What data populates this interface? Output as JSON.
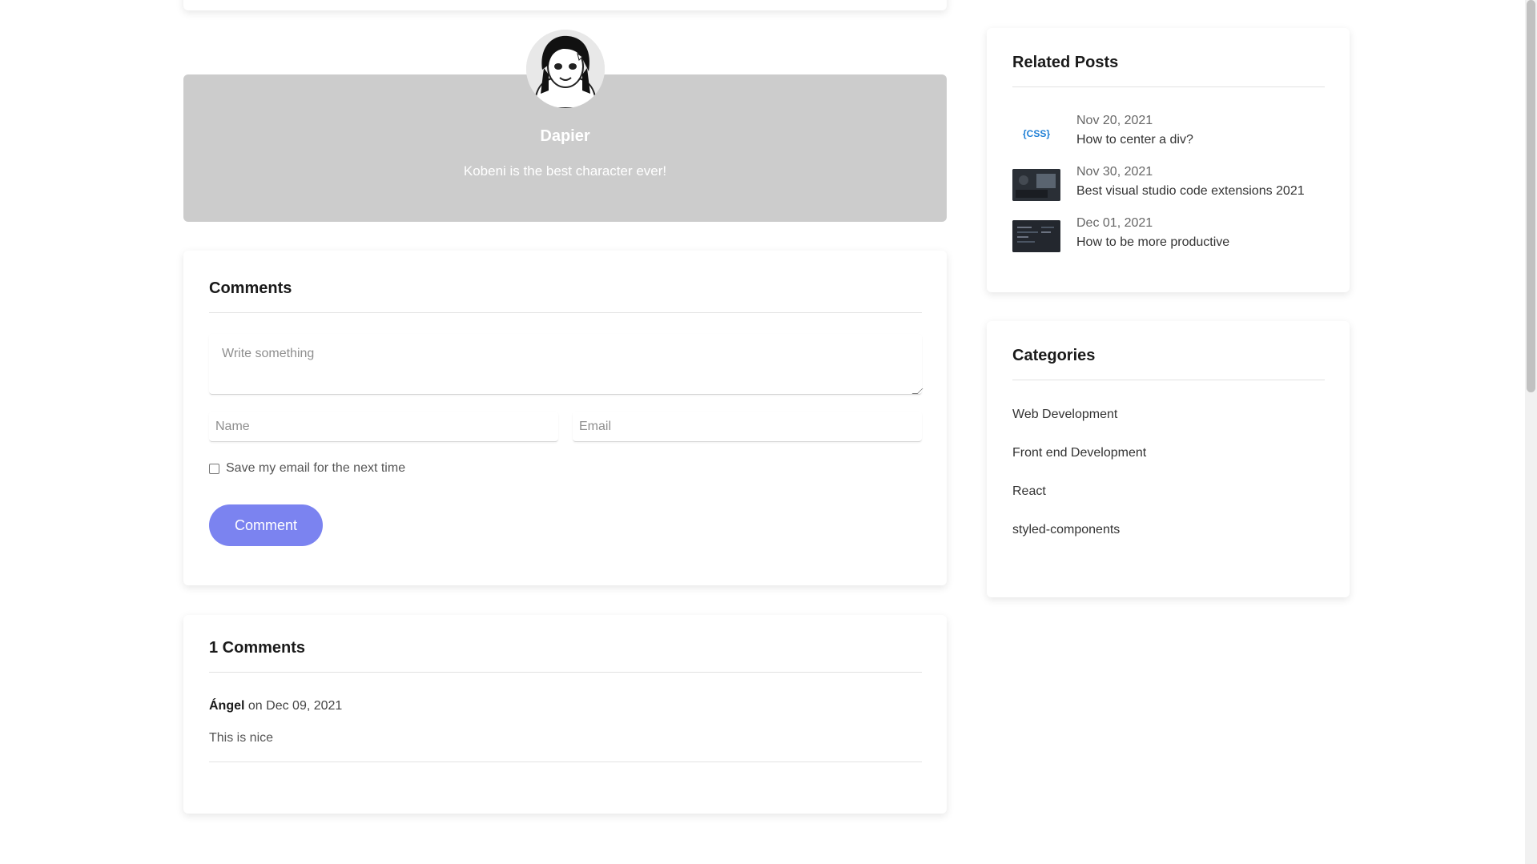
{
  "author": {
    "name": "Dapier",
    "bio": "Kobeni is the best character ever!"
  },
  "comment_form": {
    "title": "Comments",
    "message_placeholder": "Write something",
    "name_placeholder": "Name",
    "email_placeholder": "Email",
    "save_email_label": "Save my email for the next time",
    "submit_label": "Comment"
  },
  "comments_list": {
    "title": "1 Comments",
    "items": [
      {
        "author": "Ángel",
        "meta": " on Dec 09, 2021",
        "text": "This is nice"
      }
    ]
  },
  "related_posts": {
    "title": "Related Posts",
    "items": [
      {
        "thumb_text": "{CSS}",
        "date": "Nov 20, 2021",
        "title": "How to center a div?"
      },
      {
        "thumb_text": "",
        "date": "Nov 30, 2021",
        "title": "Best visual studio code extensions 2021"
      },
      {
        "thumb_text": "",
        "date": "Dec 01, 2021",
        "title": "How to be more productive"
      }
    ]
  },
  "categories": {
    "title": "Categories",
    "items": [
      "Web Development",
      "Front end Development",
      "React",
      "styled-components"
    ]
  },
  "colors": {
    "accent": "#7b83f0",
    "author_card_bg": "#cccccc"
  }
}
